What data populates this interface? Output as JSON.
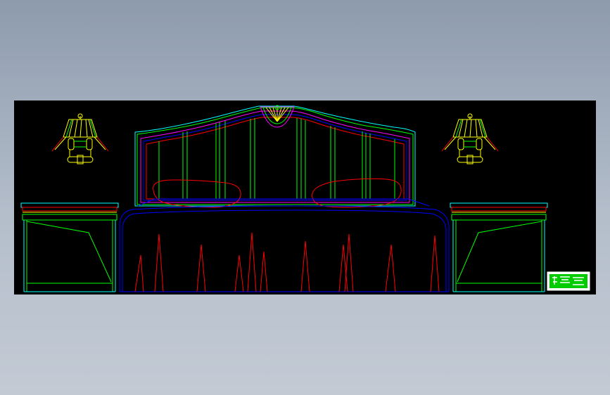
{
  "app": {
    "background_top": "#8e9bad",
    "background_bottom": "#c3cad4",
    "canvas_color": "#000000"
  },
  "drawing": {
    "subject": "",
    "stroke_colors": {
      "frame": "#00ffff",
      "headboard_outer": "#00ff00",
      "headboard_inner": "#ff0000",
      "headboard_blue": "#0000ff",
      "headboard_magenta": "#ff00ff",
      "lamp": "#ffff00",
      "pillow": "#ff0000",
      "cover": "#0000ff",
      "pleats": "#ff0000",
      "nightstand_top": "#ff0000",
      "nightstand_body": "#00ff00"
    }
  },
  "stamp": {
    "text": "",
    "bg": "#00cc00"
  }
}
